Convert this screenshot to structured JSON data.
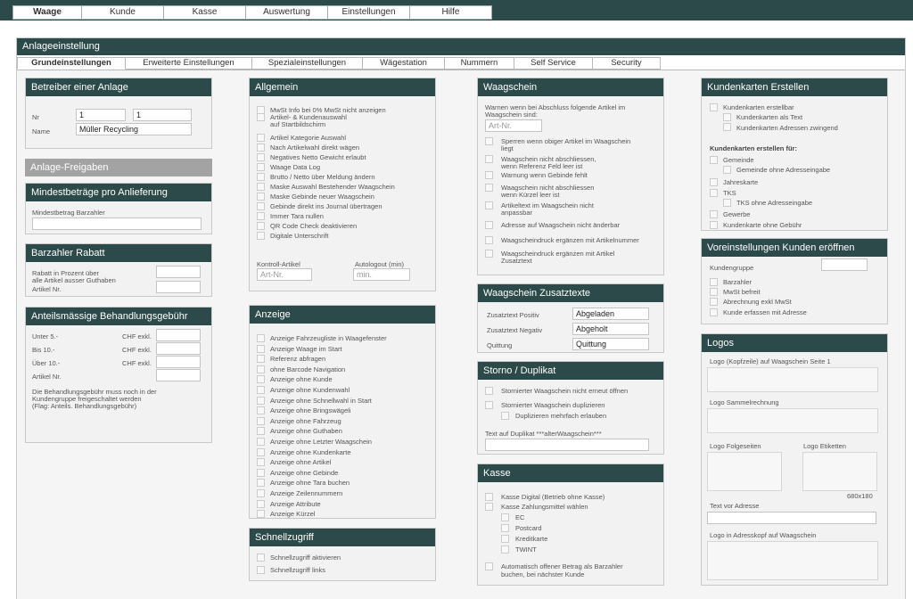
{
  "topnav": [
    "Waage",
    "Kunde",
    "Kasse",
    "Auswertung",
    "Einstellungen",
    "Hilfe"
  ],
  "frame_title": "Anlageeinstellung",
  "subtabs": [
    "Grundeinstellungen",
    "Erweiterte Einstellungen",
    "Spezialeinstellungen",
    "Wägestation",
    "Nummern",
    "Self Service",
    "Security"
  ],
  "betreiber": {
    "title": "Betreiber einer Anlage",
    "nr_label": "Nr",
    "nr_value1": "1",
    "nr_value2": "1",
    "name_label": "Name",
    "name_value": "Müller Recycling"
  },
  "freigaben": {
    "title": "Anlage-Freigaben"
  },
  "mindest": {
    "title": "Mindestbeträge pro Anlieferung",
    "label": "Mindestbetrag Barzahler"
  },
  "rabatt": {
    "title": "Barzahler Rabatt",
    "label1": "Rabatt in Prozent über",
    "label2": "alle Artikel ausser Guthaben",
    "label3": "Artikel Nr."
  },
  "anteil": {
    "title": "Anteilsmässige Behandlungsgebühr",
    "rows": [
      {
        "label": "Unter 5.-",
        "unit": "CHF exkl."
      },
      {
        "label": "Bis 10.-",
        "unit": "CHF exkl."
      },
      {
        "label": "Über 10.-",
        "unit": "CHF exkl."
      },
      {
        "label": "Artikel Nr.",
        "unit": ""
      }
    ],
    "note1": "Die Behandlungsgebühr muss noch in der",
    "note2": "Kundengruppe freigeschaltet werden",
    "note3": "(Flag: Anteils. Behandlungsgebühr)"
  },
  "allgemein": {
    "title": "Allgemein",
    "items": [
      "MwSt Info bei 0% MwSt nicht anzeigen",
      "Artikel- & Kundenauswahl",
      "auf Startbildschirm",
      "Artikel Kategorie Auswahl",
      "Nach Artikelwahl direkt wägen",
      "Negatives Netto Gewicht erlaubt",
      "Waage Data Log",
      "Brutto / Netto über Meldung ändern",
      "Maske Auswahl Bestehender Waagschein",
      "Maske Gebinde neuer Waagschein",
      "Gebinde direkt ins Journal übertragen",
      "Immer Tara nullen",
      "QR Code Check deaktivieren",
      "Digitale Unterschrift"
    ],
    "kontroll_label": "Kontroll-Artikel",
    "kontroll_placeholder": "Art-Nr.",
    "autologout_label": "Autologout (min)",
    "autologout_placeholder": "min."
  },
  "anzeige": {
    "title": "Anzeige",
    "items": [
      "Anzeige Fahrzeugliste in Waagefenster",
      "Anzeige Waage im Start",
      "Referenz abfragen",
      "ohne Barcode Navigation",
      "Anzeige ohne Kunde",
      "Anzeige ohne Kundenwahl",
      "Anzeige ohne Schnellwahl in Start",
      "Anzeige ohne Bringswägeli",
      "Anzeige ohne Fahrzeug",
      "Anzeige ohne Guthaben",
      "Anzeige ohne Letzter Waagschein",
      "Anzeige ohne Kundenkarte",
      "Anzeige ohne Artikel",
      "Anzeige ohne Gebinde",
      "Anzeige ohne Tara buchen",
      "Anzeige Zeilennummern",
      "Anzeige Attribute",
      "Anzeige Kürzel"
    ]
  },
  "schnell": {
    "title": "Schnellzugriff",
    "items": [
      "Schnellzugriff aktivieren",
      "Schnellzugriff links"
    ]
  },
  "waagschein": {
    "title": "Waagschein",
    "warn1": "Warnen wenn bei Abschluss folgende Artikel im",
    "warn2": "Waagschein sind:",
    "art_placeholder": "Art-Nr.",
    "items": [
      [
        "Sperren wenn obiger Artikel im Waagschein",
        "liegt"
      ],
      [
        "Waagschein nicht abschliessen,",
        "wenn Referenz Feld leer ist"
      ],
      [
        "Warnung wenn Gebinde fehlt",
        ""
      ],
      [
        "Waagschein nicht abschliessen",
        "wenn Kürzel leer ist"
      ],
      [
        "Artikeltext im Waagschein nicht",
        "anpassbar"
      ],
      [
        "Adresse auf Waagschein nicht änderbar",
        ""
      ],
      [
        "Waagscheindruck ergänzen mit Artikelnummer",
        ""
      ],
      [
        "Waagscheindruck ergänzen mit Artikel",
        "Zusatztext"
      ]
    ]
  },
  "zusatz": {
    "title": "Waagschein Zusatztexte",
    "rows": [
      {
        "label": "Zusatztext Positiv",
        "value": "Abgeladen"
      },
      {
        "label": "Zusatztext Negativ",
        "value": "Abgeholt"
      },
      {
        "label": "Quittung",
        "value": "Quittung"
      }
    ]
  },
  "storno": {
    "title": "Storno / Duplikat",
    "item1": "Stornierter Waagschein nicht erneut öffnen",
    "item2": "Stornierter Waagschein duplizieren",
    "item3": "Duplizieren mehrfach erlauben",
    "text_label": "Text auf Duplikat ***alterWaagschein***"
  },
  "kasse": {
    "title": "Kasse",
    "item1": "Kasse Digital (Betrieb ohne Kasse)",
    "item2": "Kasse Zahlungsmittel wählen",
    "subs": [
      "EC",
      "Postcard",
      "Kreditkarte",
      "TWINT"
    ],
    "item3a": "Automatisch offener Betrag als Barzahler",
    "item3b": "buchen, bei nächster Kunde"
  },
  "kk_erstellen": {
    "title": "Kundenkarten Erstellen",
    "item1": "Kundenkarten erstellbar",
    "item1a": "Kundenkarten als Text",
    "item1b": "Kundenkarten Adressen zwingend",
    "sub_title": "Kundenkarten erstellen für:",
    "item2": "Gemeinde",
    "item2a": "Gemeinde ohne Adresseingabe",
    "item3": "Jahreskarte",
    "item4": "TKS",
    "item4a": "TKS ohne Adresseingabe",
    "item5": "Gewerbe",
    "item6": "Kundenkarte ohne Gebühr"
  },
  "vorein": {
    "title": "Voreinstellungen Kunden eröffnen",
    "kg_label": "Kundengruppe",
    "items": [
      "Barzahler",
      "MwSt befreit",
      "Abrechnung exkl MwSt",
      "Kunde erfassen mit Adresse"
    ]
  },
  "logos": {
    "title": "Logos",
    "l1": "Logo (Kopfzeile) auf Waagschein Seite 1",
    "l2": "Logo Sammelrechnung",
    "l3": "Logo Folgeseiten",
    "l4": "Logo Etiketten",
    "size": "680x180",
    "l5": "Text vor Adresse",
    "l6": "Logo in Adresskopf auf Waagschein"
  }
}
